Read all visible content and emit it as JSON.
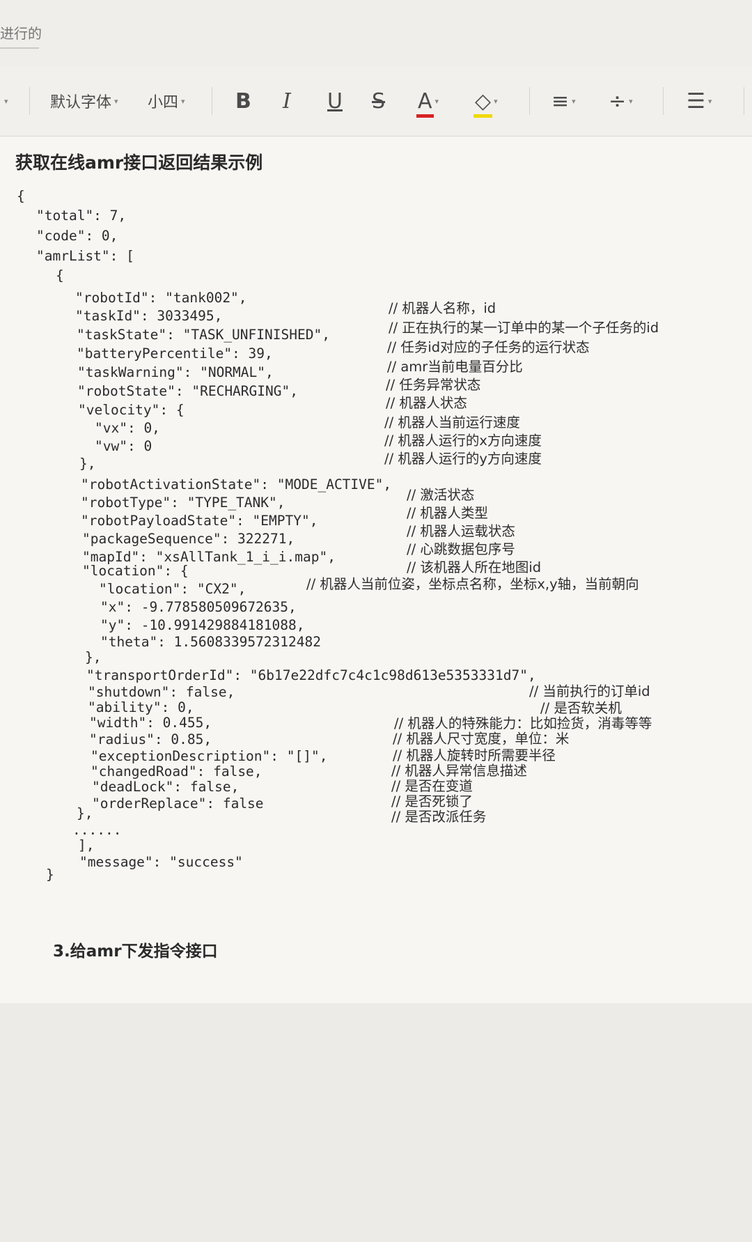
{
  "tab": {
    "label": "进行的"
  },
  "toolbar": {
    "font_family": "默认字体",
    "font_size": "小四",
    "bold": "B",
    "italic": "I",
    "underline": "U",
    "strikethrough": "S",
    "font_color": "A",
    "highlight": "◇",
    "align": "≡",
    "line_spacing": "÷",
    "list": "☰",
    "colors": {
      "font_color_bar": "#d82222",
      "highlight_bar": "#f0d800"
    }
  },
  "doc": {
    "heading": "获取在线amr接口返回结果示例",
    "code": [
      "{",
      "\"total\": 7,",
      "\"code\": 0,",
      "\"amrList\": [",
      "{",
      "\"robotId\": \"tank002\",",
      "\"taskId\": 3033495,",
      "\"taskState\": \"TASK_UNFINISHED\",",
      "\"batteryPercentile\": 39,",
      "\"taskWarning\": \"NORMAL\",",
      "\"robotState\": \"RECHARGING\",",
      "\"velocity\": {",
      "\"vx\": 0,",
      "\"vw\": 0",
      "},",
      "\"robotActivationState\": \"MODE_ACTIVE\",",
      "\"robotType\": \"TYPE_TANK\",",
      "\"robotPayloadState\": \"EMPTY\",",
      "\"packageSequence\": 322271,",
      "\"mapId\": \"xsAllTank_1_i_i.map\",",
      "\"location\": {",
      "\"location\": \"CX2\",",
      "\"x\": -9.778580509672635,",
      "\"y\": -10.991429884181088,",
      "\"theta\": 1.5608339572312482",
      "},",
      "\"transportOrderId\": \"6b17e22dfc7c4c1c98d613e5353331d7\",",
      "\"shutdown\": false,",
      "\"ability\": 0,",
      "\"width\": 0.455,",
      "\"radius\": 0.85,",
      "\"exceptionDescription\": \"[]\",",
      "\"changedRoad\": false,",
      "\"deadLock\": false,",
      "\"orderReplace\": false",
      "},",
      "......",
      "],",
      "\"message\": \"success\"",
      "}"
    ],
    "comments": [
      "// 机器人名称，id",
      "// 正在执行的某一订单中的某一个子任务的id",
      "// 任务id对应的子任务的运行状态",
      "// amr当前电量百分比",
      "// 任务异常状态",
      "// 机器人状态",
      "// 机器人当前运行速度",
      "// 机器人运行的x方向速度",
      "// 机器人运行的y方向速度",
      "// 激活状态",
      "// 机器人类型",
      "// 机器人运载状态",
      "// 心跳数据包序号",
      "// 该机器人所在地图id",
      "// 机器人当前位姿，坐标点名称，坐标x,y轴，当前朝向",
      "// 当前执行的订单id",
      "// 是否软关机",
      "// 机器人的特殊能力：比如捡货，消毒等等",
      "// 机器人尺寸宽度，单位：米",
      "// 机器人旋转时所需要半径",
      "// 机器人异常信息描述",
      "// 是否在变道",
      "// 是否死锁了",
      "// 是否改派任务"
    ],
    "section_title": "3.给amr下发指令接口"
  }
}
